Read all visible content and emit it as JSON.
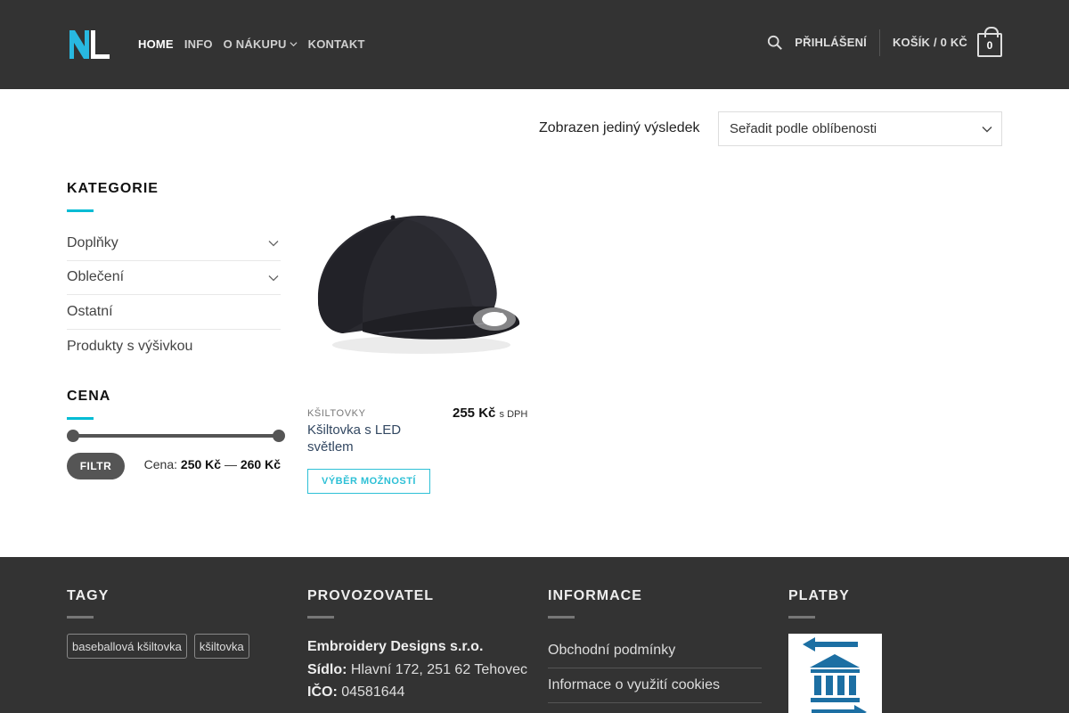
{
  "header": {
    "nav": [
      {
        "label": "HOME",
        "active": true,
        "dropdown": false
      },
      {
        "label": "INFO",
        "active": false,
        "dropdown": false
      },
      {
        "label": "O NÁKUPU",
        "active": false,
        "dropdown": true
      },
      {
        "label": "KONTAKT",
        "active": false,
        "dropdown": false
      }
    ],
    "login_label": "PŘIHLÁŠENÍ",
    "cart_label": "KOŠÍK / 0 KČ",
    "cart_count": "0"
  },
  "toolbar": {
    "result_count": "Zobrazen jediný výsledek",
    "sort_selected": "Seřadit podle oblíbenosti"
  },
  "sidebar": {
    "categories_title": "KATEGORIE",
    "categories": [
      {
        "label": "Doplňky",
        "expandable": true
      },
      {
        "label": "Oblečení",
        "expandable": true
      },
      {
        "label": "Ostatní",
        "expandable": false
      },
      {
        "label": "Produkty s výšivkou",
        "expandable": false
      }
    ],
    "price_title": "CENA",
    "filter_label": "FILTR",
    "price_prefix": "Cena:",
    "price_min": "250 Kč",
    "price_sep": "—",
    "price_max": "260 Kč"
  },
  "product": {
    "category": "KŠILTOVKY",
    "name": "Kšiltovka s LED světlem",
    "price": "255 Kč",
    "price_suffix": "s DPH",
    "options_label": "VÝBĚR MOŽNOSTÍ"
  },
  "footer": {
    "tags_title": "TAGY",
    "tags": [
      "baseballová kšiltovka",
      "kšiltovka"
    ],
    "operator_title": "PROVOZOVATEL",
    "company_name": "Embroidery Designs s.r.o.",
    "seat_label": "Sídlo:",
    "seat_value": "Hlavní 172, 251 62 Tehovec",
    "ico_label": "IČO:",
    "ico_value": "04581644",
    "info_title": "INFORMACE",
    "info_links": [
      "Obchodní podmínky",
      "Informace o využití cookies"
    ],
    "payments_title": "PLATBY"
  },
  "colors": {
    "header_bg": "#333333",
    "accent": "#2ec0d6",
    "title_underline": "#00bcd4"
  },
  "icons": {
    "search": "search-icon",
    "chevron": "chevron-down-icon",
    "cart": "cart-bag-icon",
    "bank": "bank-transfer-icon"
  }
}
